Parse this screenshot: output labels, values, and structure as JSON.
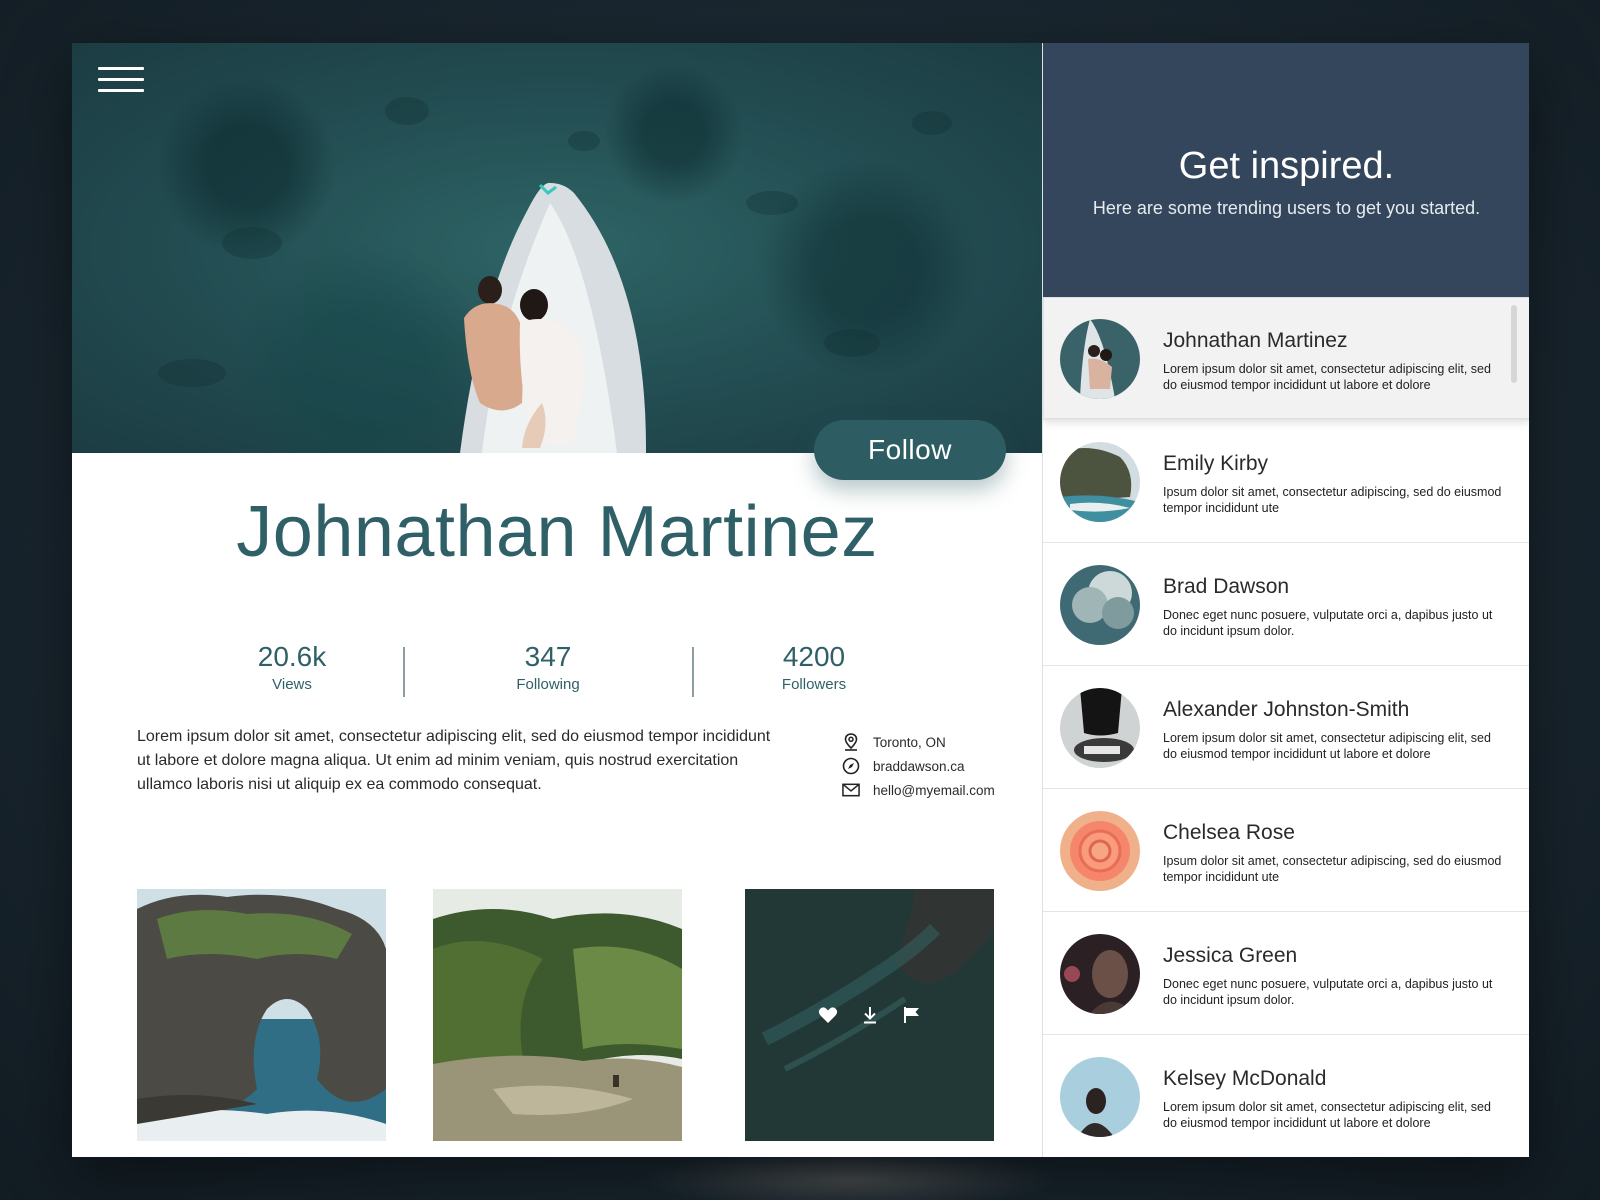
{
  "profile": {
    "name": "Johnathan Martinez",
    "follow_label": "Follow",
    "stats": [
      {
        "value": "20.6k",
        "label": "Views"
      },
      {
        "value": "347",
        "label": "Following"
      },
      {
        "value": "4200",
        "label": "Followers"
      }
    ],
    "bio": "Lorem ipsum dolor sit amet, consectetur adipiscing elit, sed do eiusmod tempor incididunt ut labore et dolore magna aliqua. Ut enim ad minim veniam, quis nostrud exercitation ullamco laboris nisi ut aliquip ex ea commodo consequat.",
    "contacts": {
      "location": "Toronto, ON",
      "website": "braddawson.ca",
      "email": "hello@myemail.com"
    }
  },
  "sidebar": {
    "title": "Get inspired.",
    "subtitle": "Here are some trending users to get you started.",
    "users": [
      {
        "name": "Johnathan Martinez",
        "desc": "Lorem ipsum dolor sit amet, consectetur adipiscing elit, sed do eiusmod tempor incididunt ut labore et dolore"
      },
      {
        "name": "Emily Kirby",
        "desc": "Ipsum dolor sit amet, consectetur adipiscing, sed do eiusmod tempor incididunt ute"
      },
      {
        "name": "Brad Dawson",
        "desc": "Donec eget nunc posuere, vulputate orci a, dapibus justo ut do incidunt ipsum dolor."
      },
      {
        "name": "Alexander Johnston-Smith",
        "desc": "Lorem ipsum dolor sit amet, consectetur adipiscing elit, sed do eiusmod tempor incididunt ut labore et dolore"
      },
      {
        "name": "Chelsea Rose",
        "desc": "Ipsum dolor sit amet, consectetur adipiscing, sed do eiusmod tempor incididunt ute"
      },
      {
        "name": "Jessica Green",
        "desc": "Donec eget nunc posuere, vulputate orci a, dapibus justo ut do incidunt ipsum dolor."
      },
      {
        "name": "Kelsey McDonald",
        "desc": "Lorem ipsum dolor sit amet, consectetur adipiscing elit, sed do eiusmod tempor incididunt ut labore et dolore"
      }
    ]
  },
  "icons": {
    "menu": "hamburger-icon",
    "location": "location-pin-icon",
    "website": "compass-icon",
    "email": "envelope-icon",
    "like": "heart-icon",
    "download": "download-icon",
    "report": "flag-icon"
  },
  "colors": {
    "accent": "#2d5c63",
    "sidebar_header": "#34465b"
  }
}
